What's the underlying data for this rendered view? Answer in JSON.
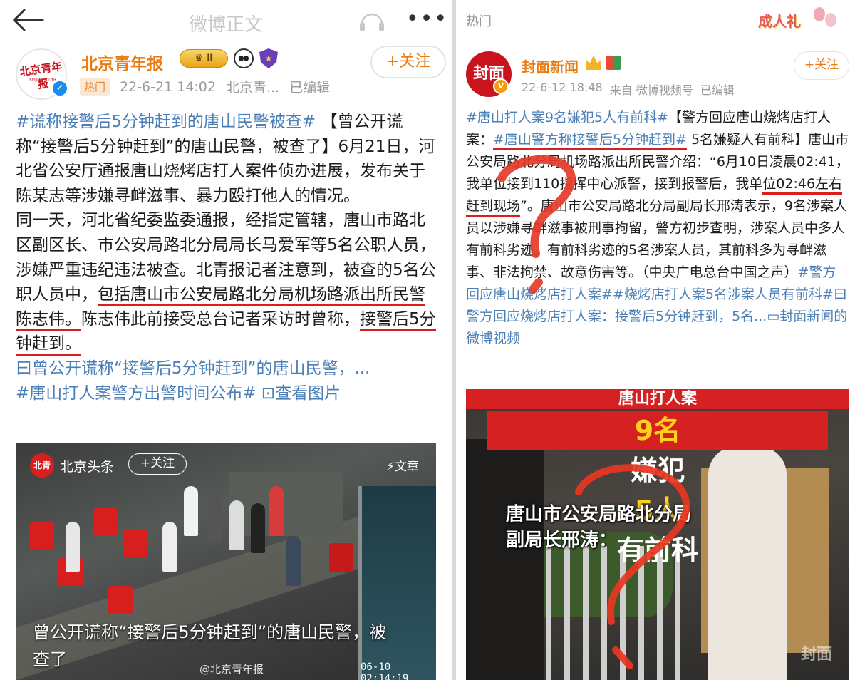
{
  "left": {
    "nav_title": "微博正文",
    "account": {
      "name": "北京青年报",
      "avatar_text": "北京青年报",
      "avatar_sub": "BEIJING YOUTH DAILY",
      "level_badge": "Ⅱ",
      "follow_label": "+关注"
    },
    "meta": {
      "hot_tag": "热门",
      "time": "22-6-21 14:02",
      "source": "北京青...",
      "edited": "已编辑"
    },
    "body": {
      "p1_tag": "#谎称接警后5分钟赶到的唐山民警被查#",
      "p1_text": "【曾公开谎称“接警后5分钟赶到”的唐山民警，被查了】6月21日，河北省公安厅通报唐山烧烤店打人案件侦办进展，发布关于陈某志等涉嫌寻衅滋事、暴力殴打他人的情况。",
      "p2_pre": "同一天，河北省纪委监委通报，经指定管辖，唐山市路北区副区长、市公安局路北分局局长马爱军等5名公职人员，涉嫌严重违纪违法被查。北青报记者注意到，被查的5名公职人员中，",
      "p2_ul1": "包括唐山市公安局路北分局机场路派出所民警陈志伟。",
      "p2_mid": "陈志伟此前接受总台记者采访时曾称，",
      "p2_ul2": "接警后5分钟赶到。",
      "link_text": "曰曾公开谎称“接警后5分钟赶到”的唐山民警，...",
      "tag2": "#唐山打人案警方出警时间公布#",
      "view_images": "查看图片"
    },
    "video": {
      "source": "北京头条",
      "logo_text": "北青",
      "follow_label": "+关注",
      "article_label": "文章",
      "caption": "曾公开谎称“接警后5分钟赶到”的唐山民警，被查了",
      "watermark": "@北京青年报",
      "timestamp": "06-10 02:14:19"
    }
  },
  "right": {
    "hot_label": "热门",
    "banner": "成人礼",
    "account": {
      "name": "封面新闻",
      "avatar_text": "封面",
      "follow_label": "+关注"
    },
    "meta": {
      "time": "22-6-12 18:48",
      "via": "来自 微博视频号",
      "edited": "已编辑"
    },
    "body": {
      "tag1": "#唐山打人案9名嫌犯5人有前科#",
      "t1": "【警方回应唐山烧烤店打人案：",
      "tag2": "#唐山警方称接警后5分钟赶到#",
      "t2": "5名嫌疑人有前科】唐山市公安局路北分局机场路派出所民警介绍：“6月10日凌晨02:41，我单位接到110指挥中心派警，接到报警后，我单",
      "ul": "位02:46左右赶到现场",
      "t3": "”。唐山市公安局路北分局副局长邢涛表示，9名涉案人员以涉嫌寻衅滋事被刑事拘留，警方初步查明，涉案人员中多人有前科劣迹。有前科劣迹的5名涉案人员，其前科多为寻衅滋事、非法拘禁、故意伤害等。（中央广电总台中国之声）",
      "tags": "#警方回应唐山烧烤店打人案##烧烤店打人案5名涉案人员有前科#",
      "link": "曰警方回应烧烤店打人案：接警后5分钟赶到，5名...",
      "video_link": "封面新闻的微博视频"
    },
    "video": {
      "banner_top": "唐山打人案",
      "banner_main_a": "9名",
      "banner_main_b": "嫌犯",
      "banner_main_c": "5人",
      "banner_main_d": "有前科",
      "caption_line1": "唐山市公安局路北分局",
      "caption_line2": "副局长邢涛：",
      "watermark": "封面"
    }
  },
  "colors": {
    "accent_orange": "#e87d16",
    "link_blue": "#4a7fb8",
    "annotation_red": "#d81e1e"
  }
}
